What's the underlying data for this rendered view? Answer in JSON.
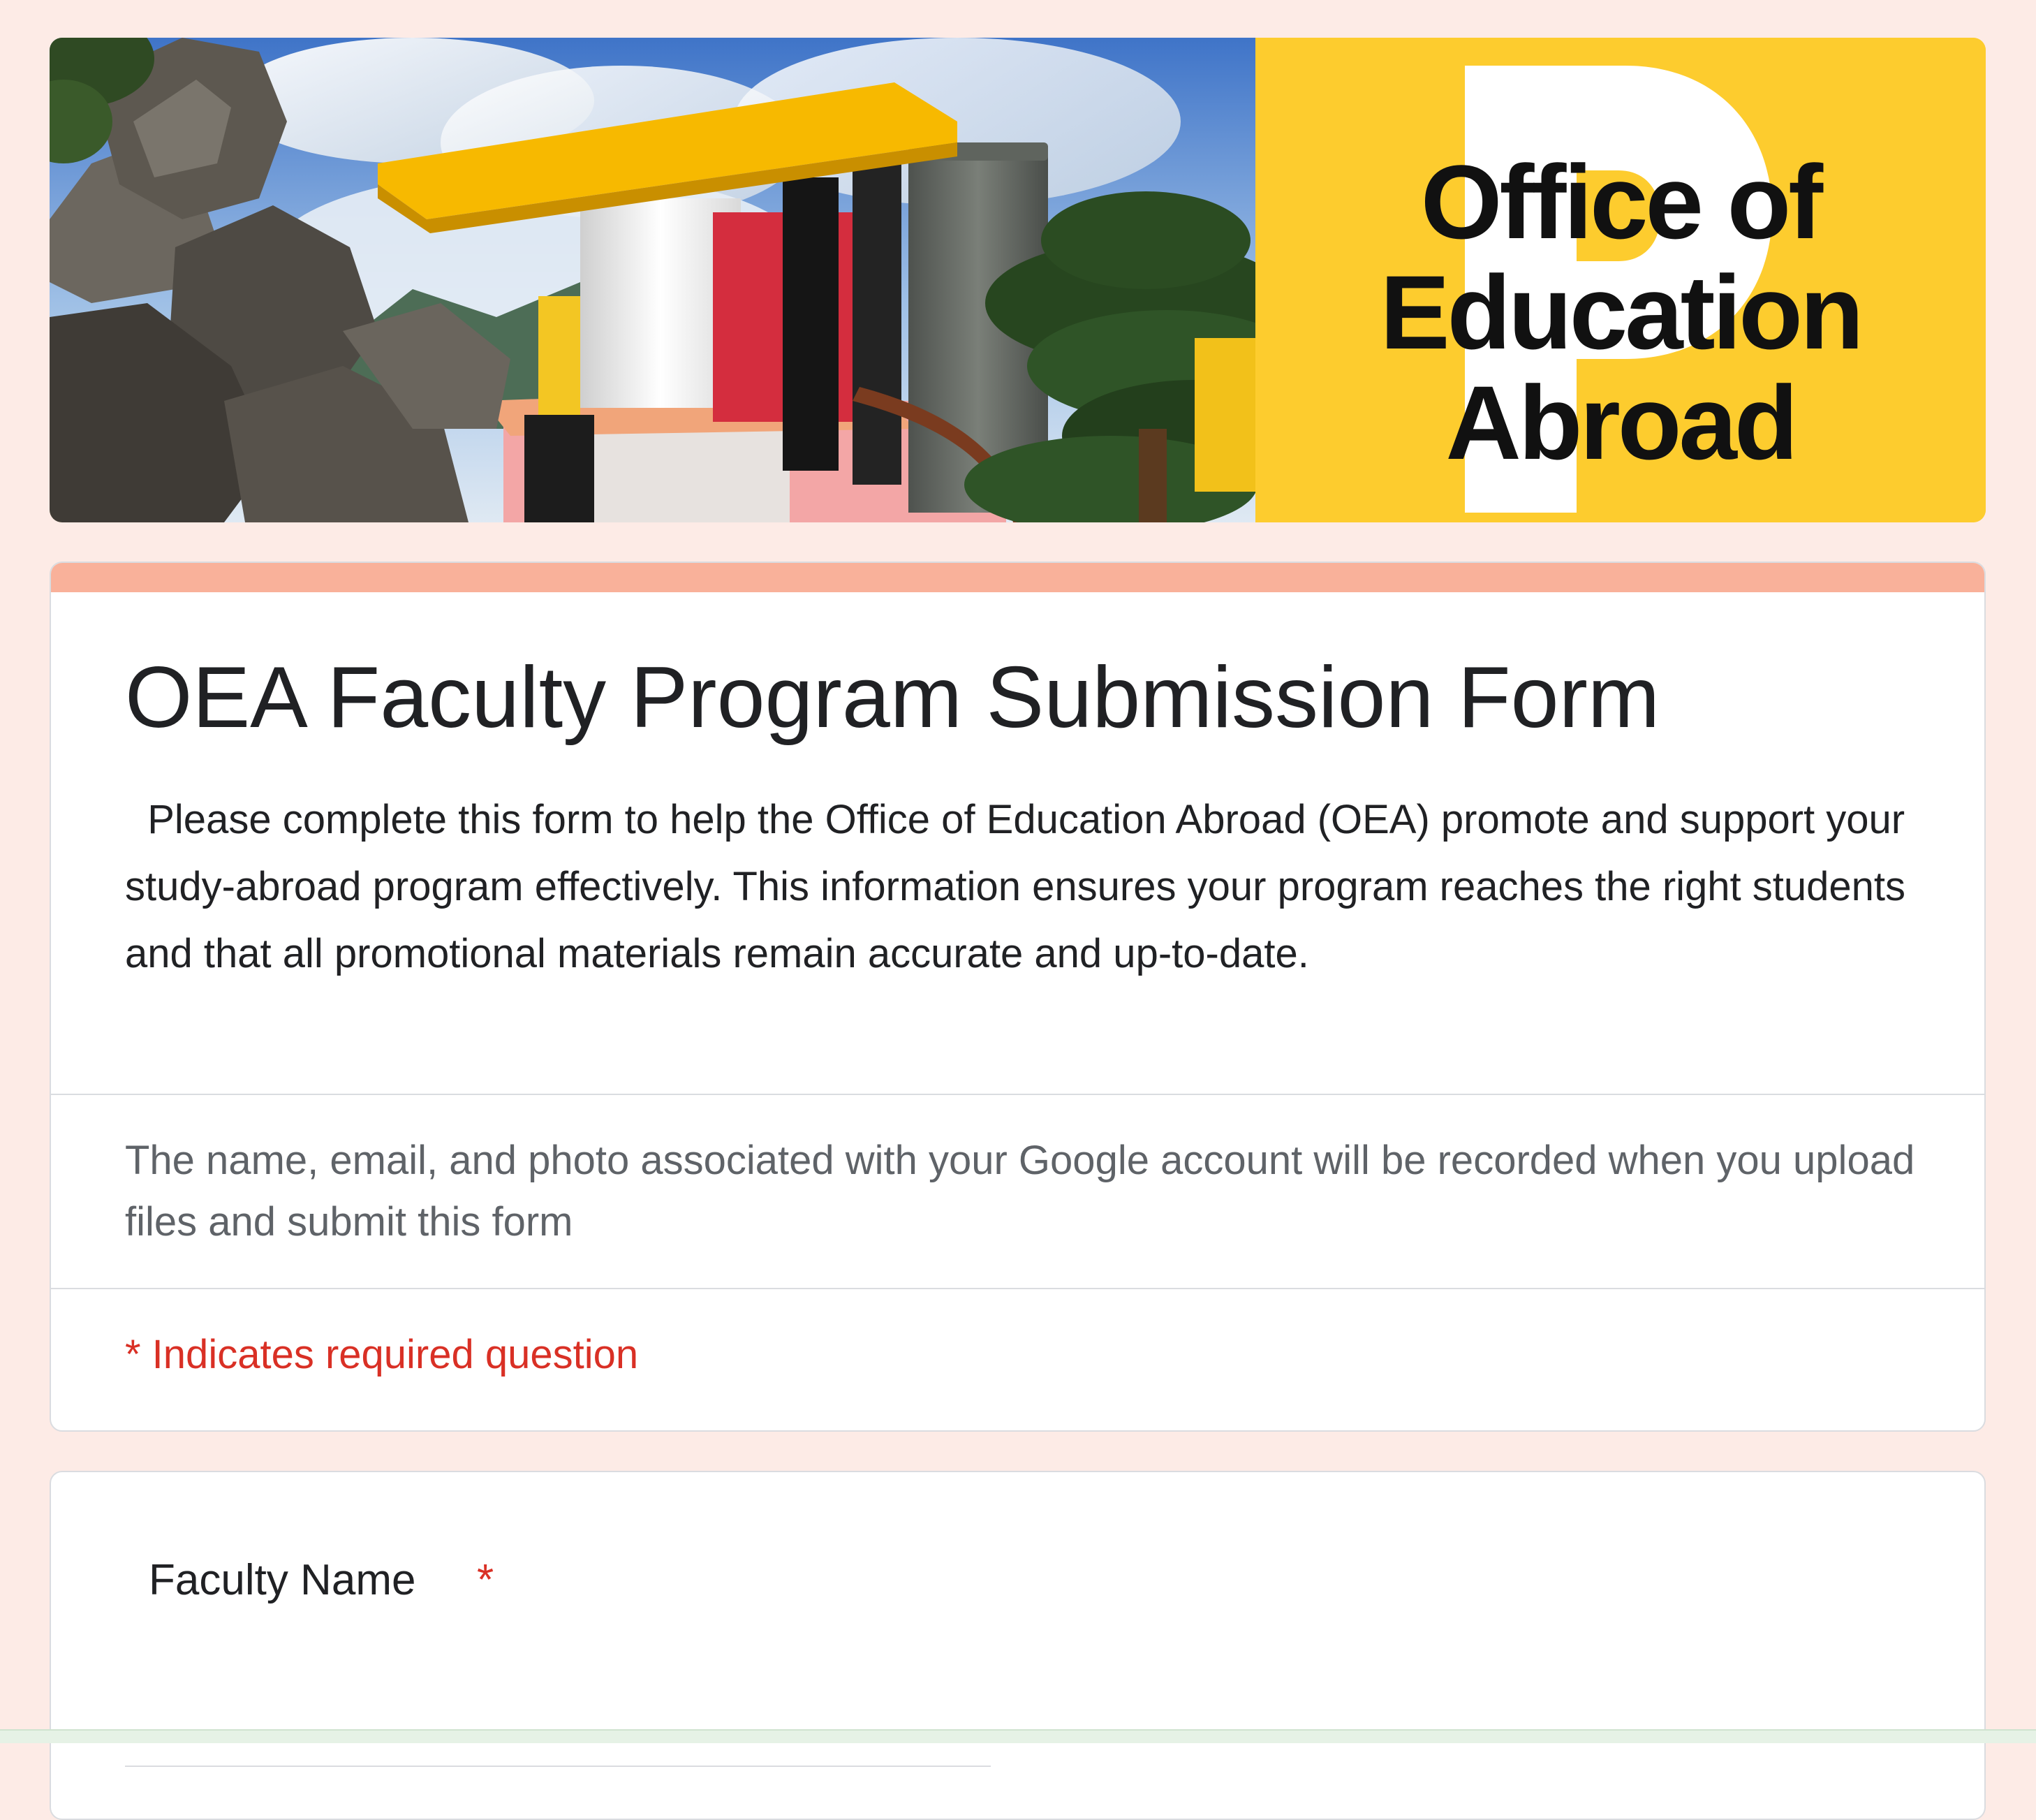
{
  "banner": {
    "logo_lines": [
      "Office of",
      "Education",
      "Abroad"
    ],
    "logo_letter": "P",
    "colors": {
      "logo_panel": "#fdcc2e",
      "logo_letter": "#ffffff",
      "logo_text": "#111111"
    }
  },
  "form": {
    "title": "OEA Faculty Program Submission Form",
    "description": "  Please complete this form to help the Office of Education Abroad (OEA) promote and support your study-abroad program effectively. This information ensures your program reaches the right students and that all promotional materials remain accurate and up-to-date.",
    "account_notice": "The name, email, and photo associated with your Google account will be recorded when you upload files and submit this form",
    "required_note": "* Indicates required question",
    "accent_color": "#f9b19a",
    "required_color": "#d93025"
  },
  "questions": [
    {
      "label": "Faculty Name",
      "required_marker": "*",
      "placeholder": ""
    }
  ]
}
